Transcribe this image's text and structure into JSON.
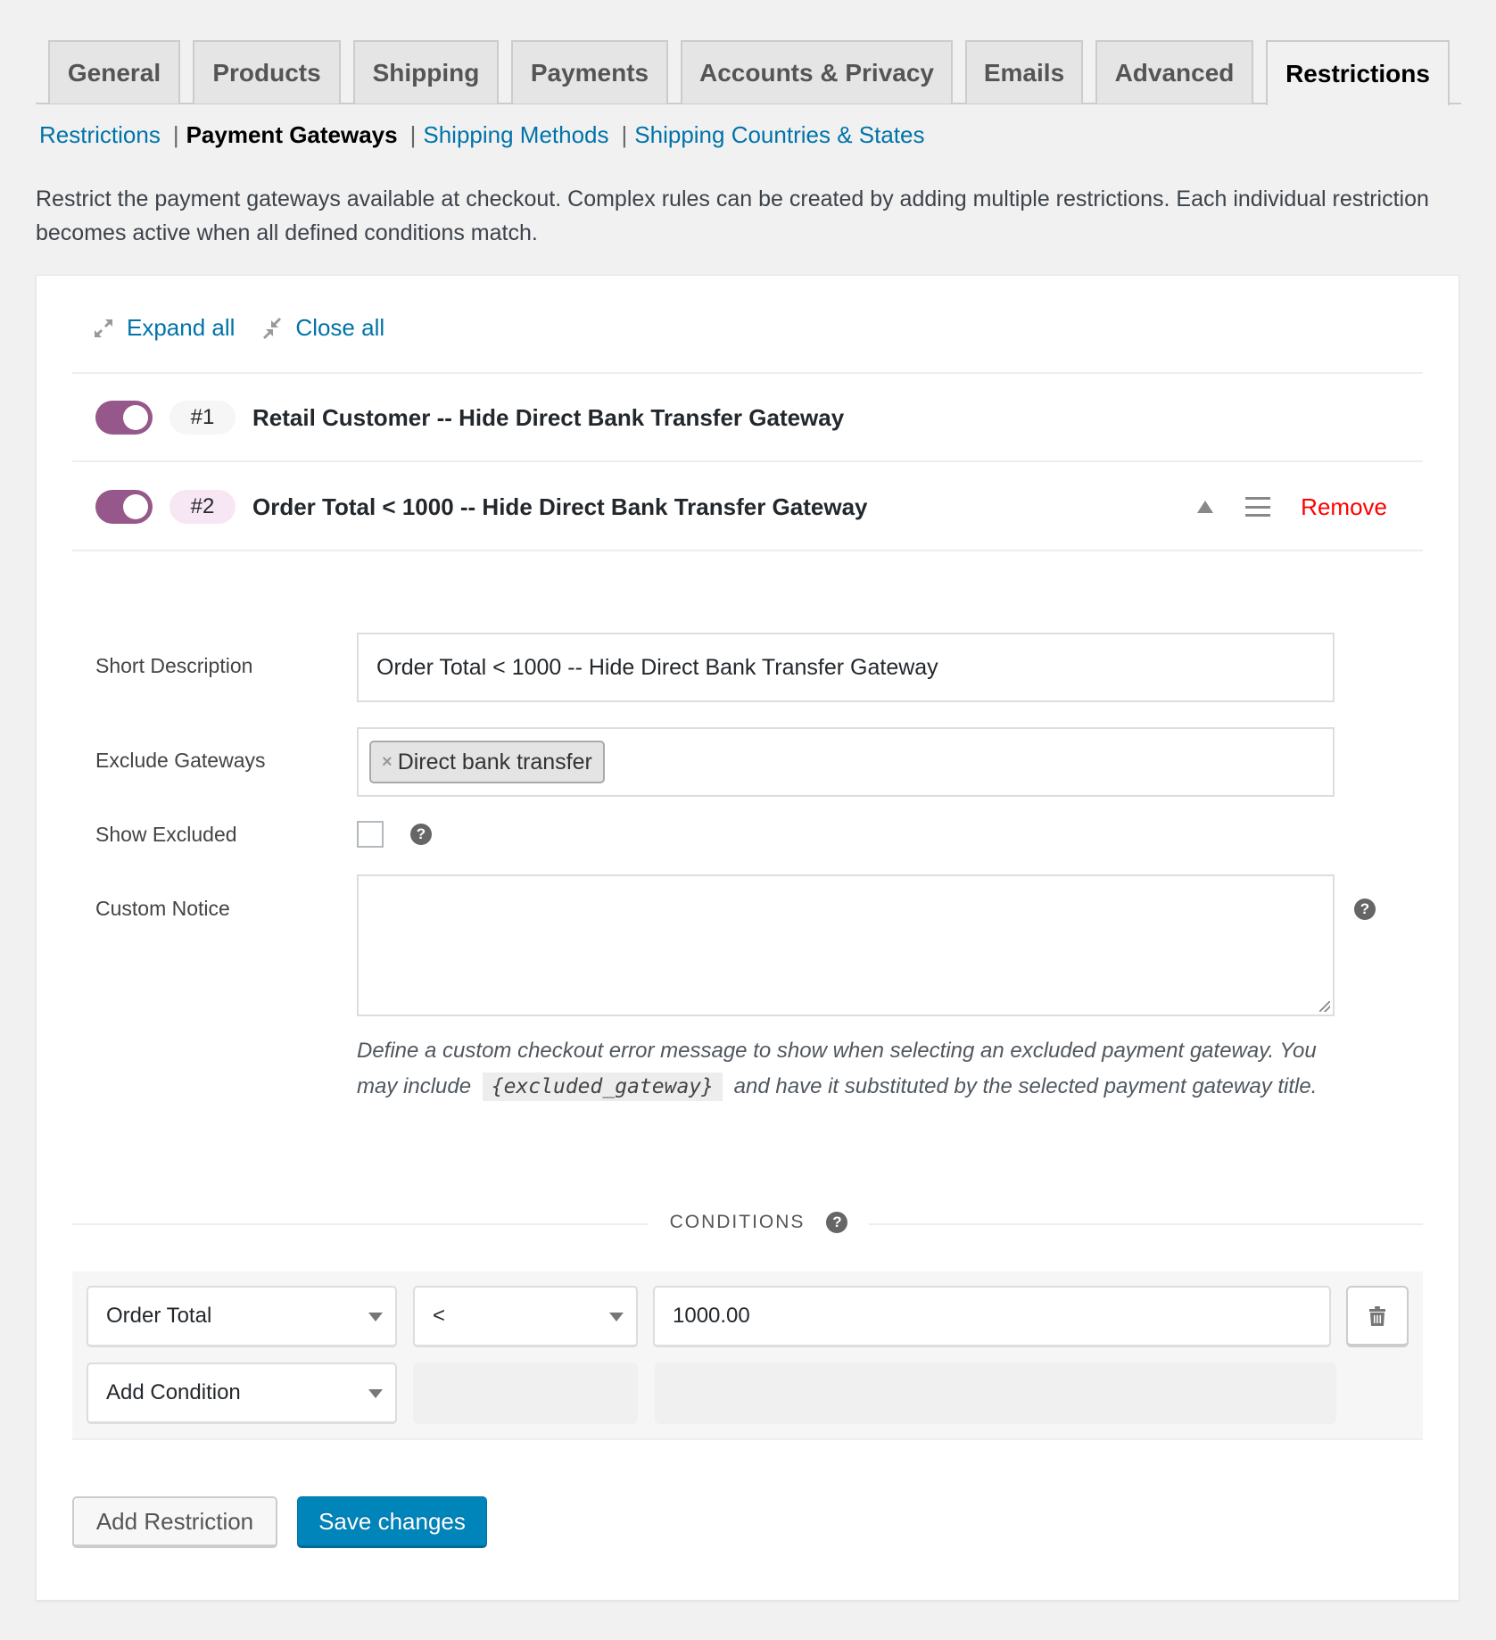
{
  "tabs": [
    {
      "label": "General",
      "active": false
    },
    {
      "label": "Products",
      "active": false
    },
    {
      "label": "Shipping",
      "active": false
    },
    {
      "label": "Payments",
      "active": false
    },
    {
      "label": "Accounts & Privacy",
      "active": false
    },
    {
      "label": "Emails",
      "active": false
    },
    {
      "label": "Advanced",
      "active": false
    },
    {
      "label": "Restrictions",
      "active": true
    }
  ],
  "subnav": {
    "items": [
      {
        "label": "Restrictions",
        "current": false
      },
      {
        "label": "Payment Gateways",
        "current": true
      },
      {
        "label": "Shipping Methods",
        "current": false
      },
      {
        "label": "Shipping Countries & States",
        "current": false
      }
    ],
    "separator": "|"
  },
  "description": "Restrict the payment gateways available at checkout. Complex rules can be created by adding multiple restrictions. Each individual restriction becomes active when all defined conditions match.",
  "toolbar": {
    "expand_all": "Expand all",
    "close_all": "Close all"
  },
  "restrictions": [
    {
      "number": "#1",
      "title": "Retail Customer -- Hide Direct Bank Transfer Gateway",
      "enabled": true,
      "expanded": false
    },
    {
      "number": "#2",
      "title": "Order Total < 1000 -- Hide Direct Bank Transfer Gateway",
      "enabled": true,
      "expanded": true,
      "remove_label": "Remove"
    }
  ],
  "form": {
    "short_description": {
      "label": "Short Description",
      "value": "Order Total < 1000 -- Hide Direct Bank Transfer Gateway"
    },
    "exclude_gateways": {
      "label": "Exclude Gateways",
      "selected": [
        "Direct bank transfer"
      ],
      "remove_glyph": "×"
    },
    "show_excluded": {
      "label": "Show Excluded",
      "checked": false
    },
    "custom_notice": {
      "label": "Custom Notice",
      "value": "",
      "help_before": "Define a custom checkout error message to show when selecting an excluded payment gateway. You may include",
      "help_code": "{excluded_gateway}",
      "help_after": "and have it substituted by the selected payment gateway title."
    },
    "help_glyph": "?"
  },
  "conditions": {
    "title": "CONDITIONS",
    "rows": [
      {
        "field": "Order Total",
        "operator": "<",
        "value": "1000.00"
      }
    ],
    "add_condition_label": "Add Condition"
  },
  "buttons": {
    "add_restriction": "Add Restriction",
    "save_changes": "Save changes"
  },
  "colors": {
    "toggle_on": "#96588a",
    "link": "#0073aa",
    "remove": "#ff0000",
    "primary": "#0085ba"
  }
}
